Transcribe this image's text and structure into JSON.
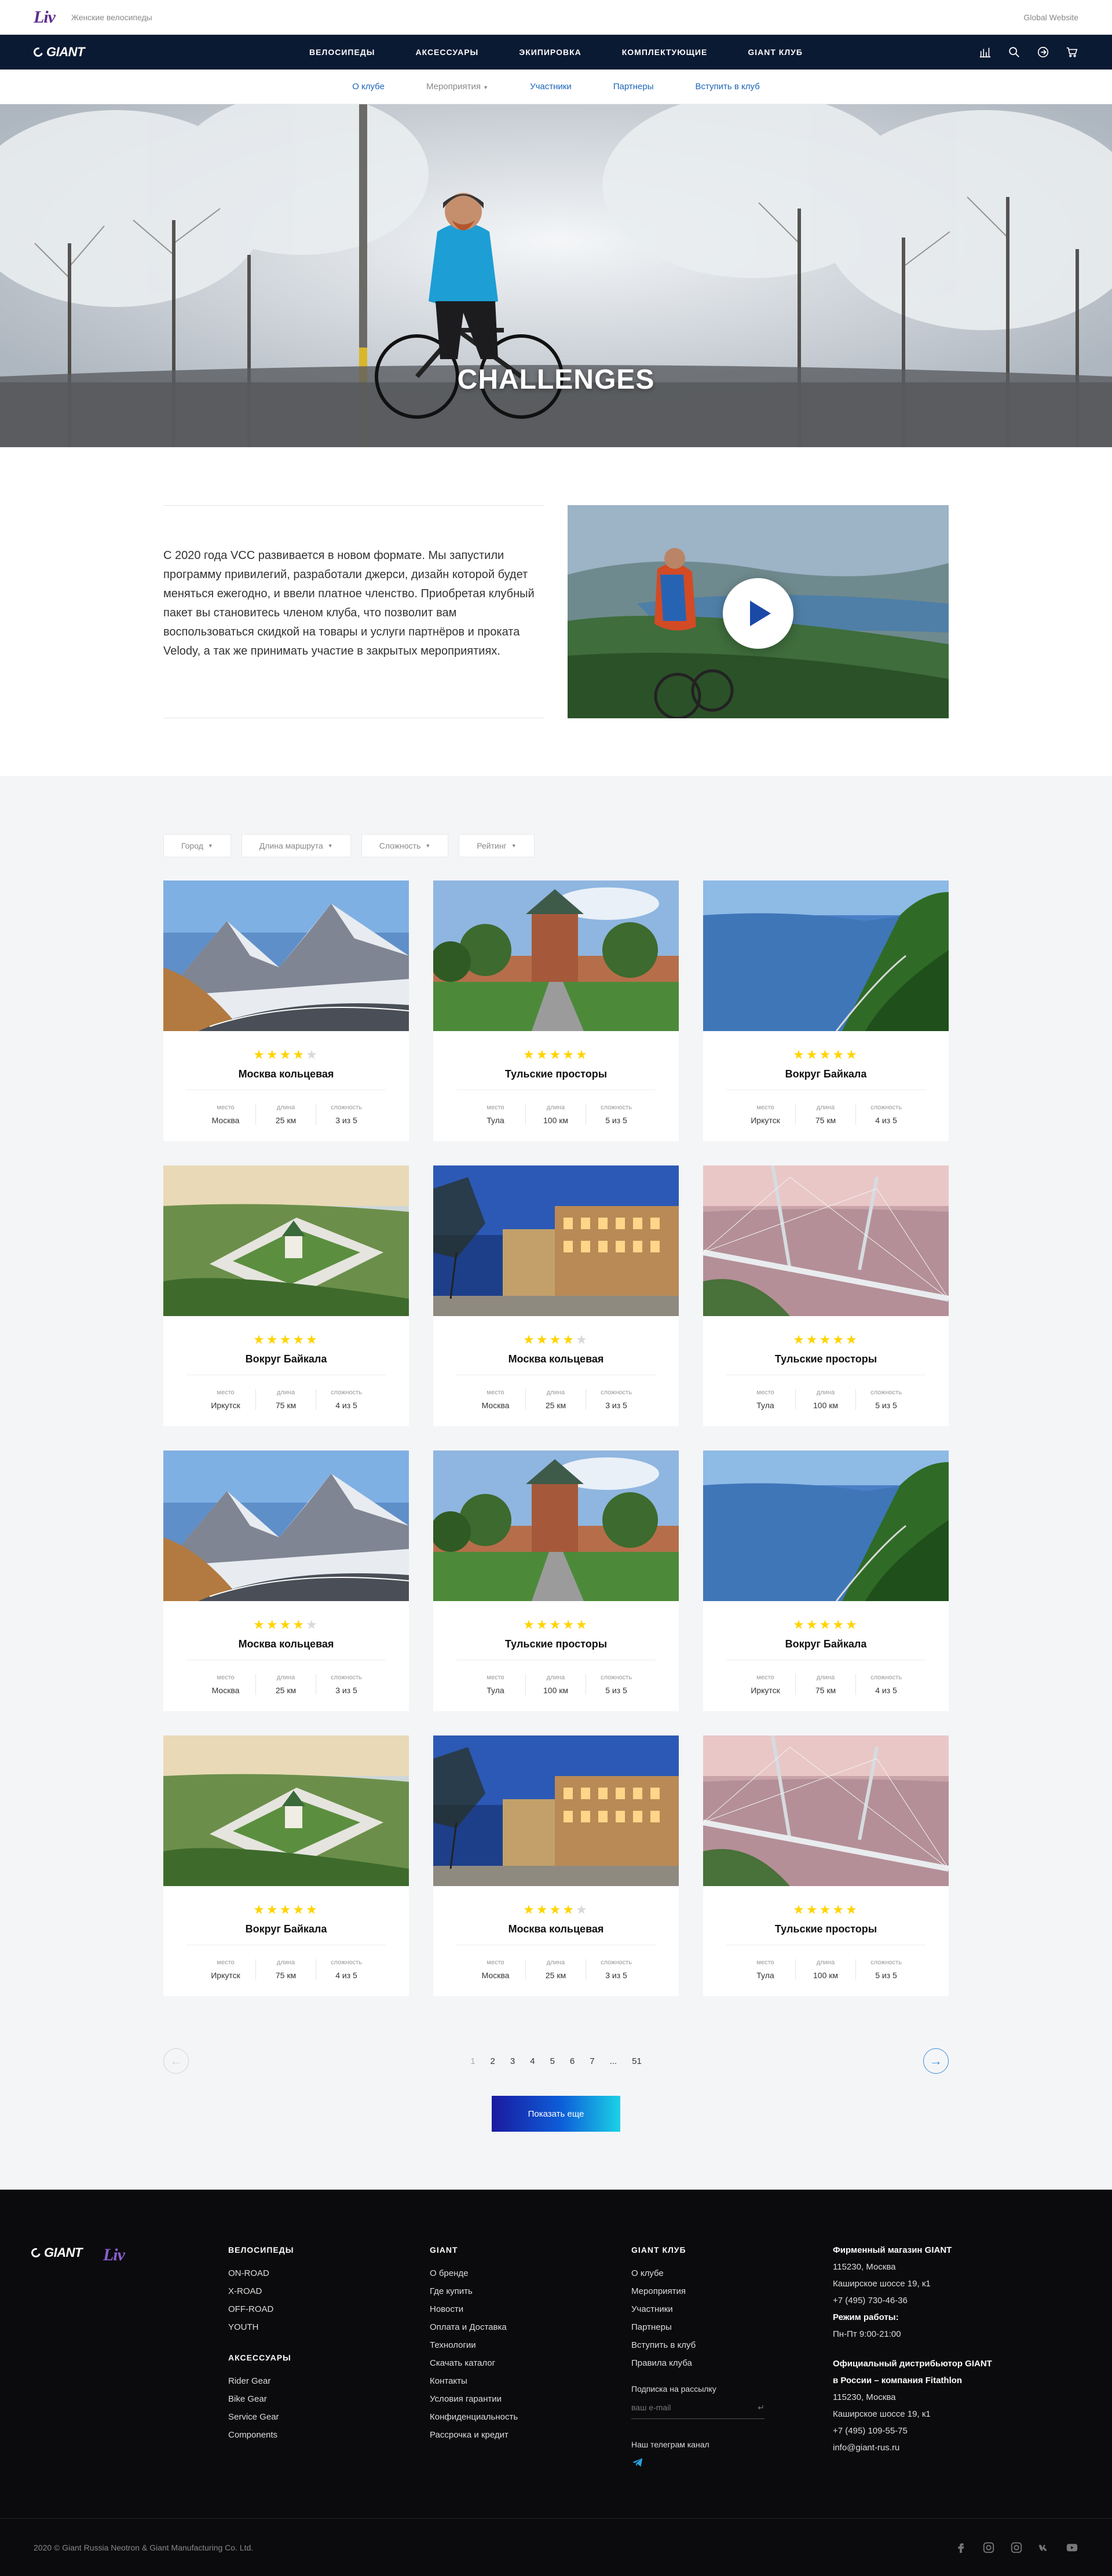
{
  "top": {
    "logo": "Liv",
    "women_bikes": "Женские велосипеды",
    "global": "Global Website"
  },
  "nav": {
    "logo": "GIANT",
    "links": [
      "ВЕЛОСИПЕДЫ",
      "АКСЕССУАРЫ",
      "ЭКИПИРОВКА",
      "КОМПЛЕКТУЮЩИЕ",
      "GIANT КЛУБ"
    ]
  },
  "subnav": [
    "О клубе",
    "Мероприятия",
    "Участники",
    "Партнеры",
    "Вступить в клуб"
  ],
  "hero": {
    "title": "CHALLENGES"
  },
  "about": {
    "text": "С 2020 года VCC развивается в новом формате. Мы запустили программу привилегий, разработали джерси, дизайн которой будет меняться ежегодно, и ввели платное членство. Приобретая клубный пакет вы становитесь членом клуба, что позволит вам воспользоваться скидкой на товары и услуги партнёров и проката Velody, а так же принимать участие в закрытых мероприятиях."
  },
  "filters": [
    "Город",
    "Длина маршрута",
    "Сложность",
    "Рейтинг"
  ],
  "labels": {
    "place": "место",
    "length": "длина",
    "difficulty": "сложность"
  },
  "cards": [
    {
      "title": "Москва кольцевая",
      "rating": 4,
      "place": "Москва",
      "length": "25 км",
      "difficulty": "3 из 5",
      "scene": "mountain"
    },
    {
      "title": "Тульские просторы",
      "rating": 5,
      "place": "Тула",
      "length": "100 км",
      "difficulty": "5 из 5",
      "scene": "kremlin"
    },
    {
      "title": "Вокруг Байкала",
      "rating": 5,
      "place": "Иркутск",
      "length": "75 км",
      "difficulty": "4 из 5",
      "scene": "lake"
    },
    {
      "title": "Вокруг Байкала",
      "rating": 5,
      "place": "Иркутск",
      "length": "75 км",
      "difficulty": "4 из 5",
      "scene": "monastery"
    },
    {
      "title": "Москва кольцевая",
      "rating": 4,
      "place": "Москва",
      "length": "25 км",
      "difficulty": "3 из 5",
      "scene": "city"
    },
    {
      "title": "Тульские просторы",
      "rating": 5,
      "place": "Тула",
      "length": "100 км",
      "difficulty": "5 из 5",
      "scene": "bridge"
    },
    {
      "title": "Москва кольцевая",
      "rating": 4,
      "place": "Москва",
      "length": "25 км",
      "difficulty": "3 из 5",
      "scene": "mountain"
    },
    {
      "title": "Тульские просторы",
      "rating": 5,
      "place": "Тула",
      "length": "100 км",
      "difficulty": "5 из 5",
      "scene": "kremlin"
    },
    {
      "title": "Вокруг Байкала",
      "rating": 5,
      "place": "Иркутск",
      "length": "75 км",
      "difficulty": "4 из 5",
      "scene": "lake"
    },
    {
      "title": "Вокруг Байкала",
      "rating": 5,
      "place": "Иркутск",
      "length": "75 км",
      "difficulty": "4 из 5",
      "scene": "monastery"
    },
    {
      "title": "Москва кольцевая",
      "rating": 4,
      "place": "Москва",
      "length": "25 км",
      "difficulty": "3 из 5",
      "scene": "city"
    },
    {
      "title": "Тульские просторы",
      "rating": 5,
      "place": "Тула",
      "length": "100 км",
      "difficulty": "5 из 5",
      "scene": "bridge"
    }
  ],
  "pager": {
    "pages": [
      "1",
      "2",
      "3",
      "4",
      "5",
      "6",
      "7",
      "...",
      "51"
    ],
    "current": "1",
    "show_more": "Показать еще"
  },
  "footer": {
    "bikes": {
      "title": "ВЕЛОСИПЕДЫ",
      "items": [
        "ON-ROAD",
        "X-ROAD",
        "OFF-ROAD",
        "YOUTH"
      ]
    },
    "accessories": {
      "title": "АКСЕССУАРЫ",
      "items": [
        "Rider Gear",
        "Bike Gear",
        "Service Gear",
        "Components"
      ]
    },
    "giant": {
      "title": "GIANT",
      "items": [
        "О бренде",
        "Где купить",
        "Новости",
        "Оплата и Доставка",
        "Технологии",
        "Скачать каталог",
        "Контакты",
        "Условия гарантии",
        "Конфиденциальность",
        "Рассрочка и кредит"
      ]
    },
    "club": {
      "title": "GIANT КЛУБ",
      "items": [
        "О клубе",
        "Мероприятия",
        "Участники",
        "Партнеры",
        "Вступить в клуб",
        "Правила клуба"
      ],
      "subscribe": "Подписка на рассылку",
      "email_placeholder": "ваш e-mail",
      "telegram": "Наш телеграм канал"
    },
    "contacts": {
      "store_title": "Фирменный магазин GIANT",
      "store_lines": [
        "115230, Москва",
        "Каширское шоссе 19, к1",
        "+7 (495) 730-46-36"
      ],
      "hours_title": "Режим работы:",
      "hours": "Пн-Пт 9:00-21:00",
      "dist_title_1": "Официальный дистрибьютор GIANT",
      "dist_title_2": "в России – компания Fitathlon",
      "dist_lines": [
        "115230, Москва",
        "Каширское шоссе 19, к1",
        "+7 (495) 109-55-75",
        "info@giant-rus.ru"
      ]
    },
    "copyright": "2020 © Giant Russia Neotron & Giant Manufacturing Co. Ltd."
  }
}
